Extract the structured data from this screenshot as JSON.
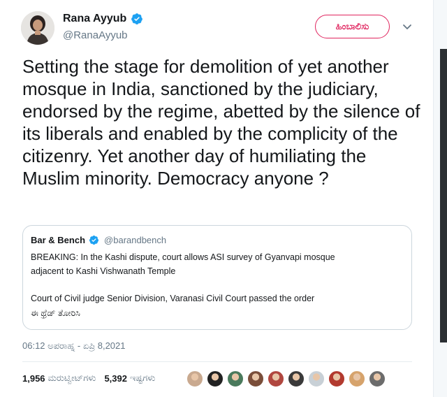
{
  "header": {
    "display_name": "Rana Ayyub",
    "handle": "@RanaAyyub",
    "follow_label": "ಹಿಂಬಾಲಿಸು",
    "verified_color": "#1da1f2",
    "follow_color": "#e0245e"
  },
  "tweet": {
    "text": "Setting the stage for demolition of yet another mosque in India, sanctioned by the judiciary, endorsed by the regime, abetted by the silence of its liberals and enabled by the complicity of the citizenry. Yet another day of humiliating the Muslim minority. Democracy anyone ?"
  },
  "quote": {
    "name": "Bar & Bench",
    "handle": "@barandbench",
    "line1": "BREAKING: In the Kashi dispute, court allows ASI survey of Gyanvapi mosque",
    "line2": "adjacent to Kashi Vishwanath Temple",
    "line3": "Court of Civil judge Senior Division, Varanasi Civil Court passed the order",
    "show_thread": "ಈ ಥ್ರೆಡ್ ತೋರಿಸಿ"
  },
  "meta": {
    "timestamp": "06:12 ಅಪರಾಹ್ನ - ಏಪ್ರಿ 8,2021"
  },
  "stats": {
    "retweets_count": "1,956",
    "retweets_label": "ಮರುಟ್ವೀಟ್‌ಗಳು",
    "likes_count": "5,392",
    "likes_label": "ಇಷ್ಟಗಳು"
  },
  "likers": [
    {
      "name": "liker-avatar-1",
      "color": "#c9a98f"
    },
    {
      "name": "liker-avatar-2",
      "color": "#222222"
    },
    {
      "name": "liker-avatar-3",
      "color": "#4a7a5c"
    },
    {
      "name": "liker-avatar-4",
      "color": "#7a4e3a"
    },
    {
      "name": "liker-avatar-5",
      "color": "#b0473f"
    },
    {
      "name": "liker-avatar-6",
      "color": "#3a3a3a"
    },
    {
      "name": "liker-avatar-7",
      "color": "#c8d0d6"
    },
    {
      "name": "liker-avatar-8",
      "color": "#b23a2f"
    },
    {
      "name": "liker-avatar-9",
      "color": "#d6a36c"
    },
    {
      "name": "liker-avatar-10",
      "color": "#6c6c6c"
    }
  ]
}
